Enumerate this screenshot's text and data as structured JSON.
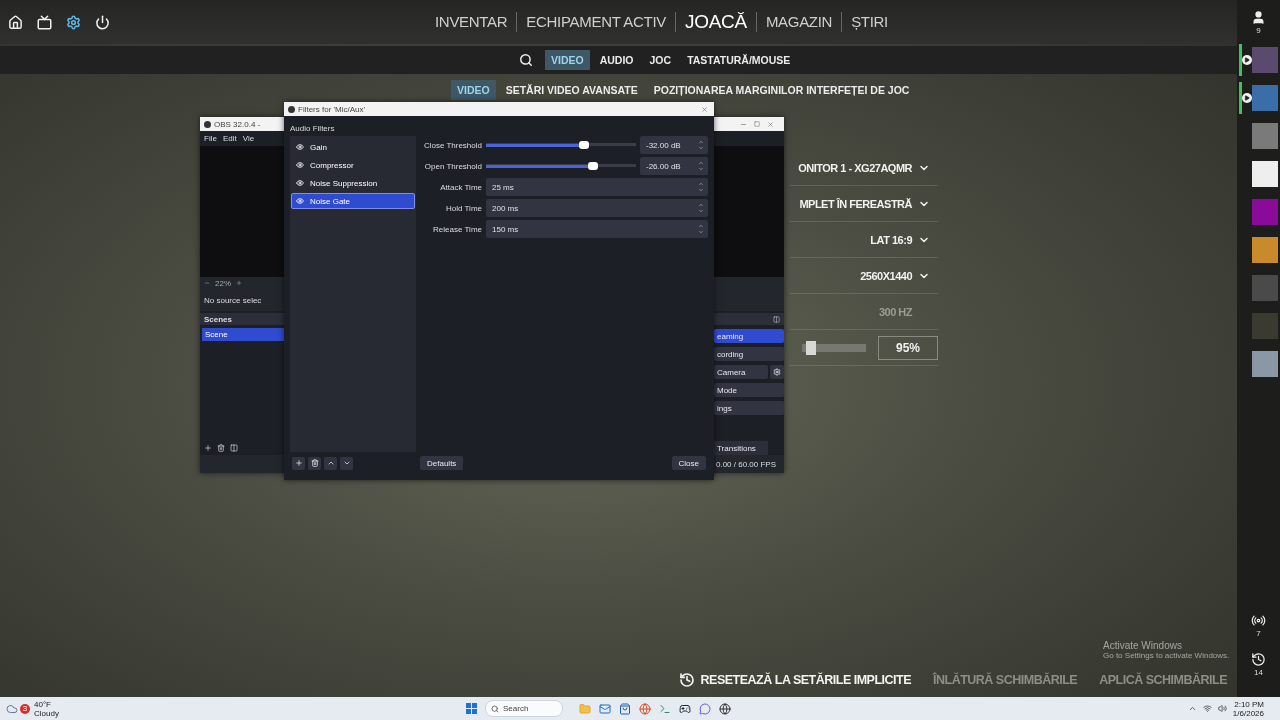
{
  "game": {
    "top_icons": [
      {
        "kind": "home",
        "selected": false
      },
      {
        "kind": "tv",
        "selected": false
      },
      {
        "kind": "settings",
        "selected": true
      },
      {
        "kind": "power",
        "selected": false
      }
    ],
    "nav_tabs": [
      {
        "label": "INVENTAR",
        "selected": false
      },
      {
        "label": "ECHIPAMENT ACTIV",
        "selected": false
      },
      {
        "label": "JOACĂ",
        "selected": true
      },
      {
        "label": "MAGAZIN",
        "selected": false
      },
      {
        "label": "ȘTIRI",
        "selected": false
      }
    ],
    "settings_tabs": [
      {
        "label": "VIDEO",
        "selected": true
      },
      {
        "label": "AUDIO",
        "selected": false
      },
      {
        "label": "JOC",
        "selected": false
      },
      {
        "label": "TASTATURĂ/MOUSE",
        "selected": false
      }
    ],
    "video_tabs": [
      {
        "label": "VIDEO",
        "selected": true
      },
      {
        "label": "SETĂRI VIDEO AVANSATE",
        "selected": false
      },
      {
        "label": "POZIȚIONAREA MARGINILOR INTERFEȚEI DE JOC",
        "selected": false
      }
    ],
    "settings": [
      {
        "kind": "dropdown",
        "value": "ONITOR 1 - XG27AQMR",
        "disabled": false
      },
      {
        "kind": "dropdown",
        "value": "MPLET ÎN FEREASTRĂ",
        "disabled": false
      },
      {
        "kind": "dropdown",
        "value": "LAT 16:9",
        "disabled": false
      },
      {
        "kind": "dropdown",
        "value": "2560X1440",
        "disabled": false
      },
      {
        "kind": "static",
        "value": "300 HZ",
        "disabled": true
      },
      {
        "kind": "slider",
        "level": 0.07,
        "value": "95%",
        "disabled": false
      }
    ],
    "actions": [
      {
        "kind": "reset",
        "label": "RESETEAZĂ LA SETĂRILE IMPLICITE",
        "disabled": false
      },
      {
        "kind": "plain",
        "label": "ÎNLĂTURĂ SCHIMBĂRILE",
        "disabled": true
      },
      {
        "kind": "plain",
        "label": "APLICĂ SCHIMBĂRILE",
        "disabled": true
      }
    ]
  },
  "sidebar": {
    "friends_count": "9",
    "avatars": [
      {
        "color": "#5a4a6e",
        "playing": true
      },
      {
        "color": "#3a6ea8",
        "playing": true
      },
      {
        "color": "#7a7a7a",
        "playing": false
      },
      {
        "color": "#eeeeee",
        "playing": false
      },
      {
        "color": "#8a0a9a",
        "playing": false
      },
      {
        "color": "#c88a2a",
        "playing": false
      },
      {
        "color": "#4a4a4a",
        "playing": false
      },
      {
        "color": "#3a3a30",
        "playing": false
      },
      {
        "color": "#8a98a6",
        "playing": false
      }
    ],
    "bottom": [
      {
        "kind": "broadcast",
        "count": "7"
      },
      {
        "kind": "history",
        "count": "14"
      }
    ]
  },
  "obs_window": {
    "title": "OBS 32.0.4 -",
    "menu": [
      "File",
      "Edit",
      "Vie"
    ],
    "zoom": "22%",
    "source_status": "No source selec",
    "scenes_title": "Scenes",
    "scenes": [
      {
        "label": "Scene",
        "selected": true
      }
    ],
    "controls": [
      {
        "label": "eaming",
        "selected": true,
        "has_settings": false
      },
      {
        "label": "cording",
        "selected": false,
        "has_settings": false
      },
      {
        "label": "Camera",
        "selected": false,
        "has_settings": true
      },
      {
        "label": "Mode",
        "selected": false,
        "has_settings": false
      },
      {
        "label": "ings",
        "selected": false,
        "has_settings": false
      }
    ],
    "transitions_tab": "Transitions",
    "fps": "0.00 / 60.00 FPS"
  },
  "filters_window": {
    "title": "Filters for 'Mic/Aux'",
    "section": "Audio Filters",
    "filters": [
      {
        "label": "Gain",
        "selected": false
      },
      {
        "label": "Compressor",
        "selected": false
      },
      {
        "label": "Noise Suppression",
        "selected": false
      },
      {
        "label": "Noise Gate",
        "selected": true
      }
    ],
    "properties": [
      {
        "kind": "slider",
        "label": "Close Threshold",
        "level": 0.65,
        "value": "-32.00 dB"
      },
      {
        "kind": "slider",
        "label": "Open Threshold",
        "level": 0.71,
        "value": "-26.00 dB"
      },
      {
        "kind": "spin",
        "label": "Attack Time",
        "value": "25 ms"
      },
      {
        "kind": "spin",
        "label": "Hold Time",
        "value": "200 ms"
      },
      {
        "kind": "spin",
        "label": "Release Time",
        "value": "150 ms"
      }
    ],
    "defaults_button": "Defaults",
    "close_button": "Close"
  },
  "activation_notice": {
    "title": "Activate Windows",
    "text": "Go to Settings to activate Windows."
  },
  "taskbar": {
    "weather_badge": "3",
    "temperature": "40°F",
    "condition": "Cloudy",
    "search_placeholder": "Search",
    "time": "2:10 PM",
    "date": "1/6/2026"
  }
}
